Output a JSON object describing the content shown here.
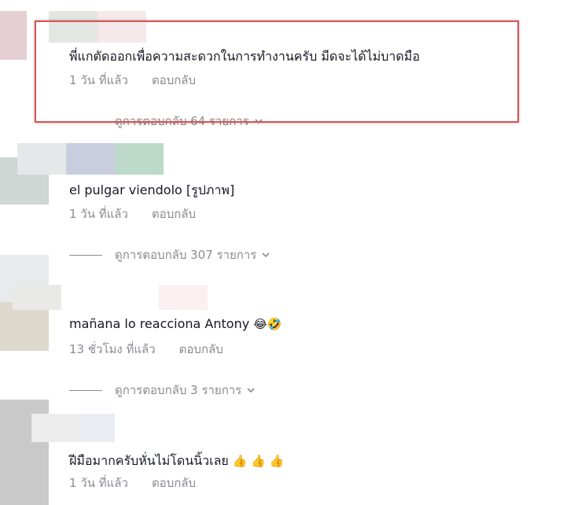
{
  "comments": [
    {
      "text": "พี่แกตัดออกเพื่อความสะดวกในการทำงานครับ มีดจะได้ไม่บาดมือ",
      "time": "1 วัน ที่แล้ว",
      "reply_label": "ตอบกลับ",
      "view_replies": "ดูการตอบกลับ 64 รายการ"
    },
    {
      "text": "el pulgar viendolo [รูปภาพ]",
      "time": "1 วัน ที่แล้ว",
      "reply_label": "ตอบกลับ",
      "view_replies": "ดูการตอบกลับ 307 รายการ"
    },
    {
      "text": "mañana lo reacciona Antony",
      "emoji": "😂🤣",
      "time": "13 ชั่วโมง ที่แล้ว",
      "reply_label": "ตอบกลับ",
      "view_replies": "ดูการตอบกลับ 3 รายการ"
    },
    {
      "text": "ฝีมือมากครับหั่นไม่โดนนิ้วเลย",
      "emoji": "👍 👍 👍",
      "time": "1 วัน ที่แล้ว",
      "reply_label": "ตอบกลับ"
    }
  ],
  "colors": {
    "text": "#161823",
    "meta": "#8a8b91",
    "highlight": "#e05252"
  },
  "icons": {
    "expand": "chevron-down-icon"
  }
}
